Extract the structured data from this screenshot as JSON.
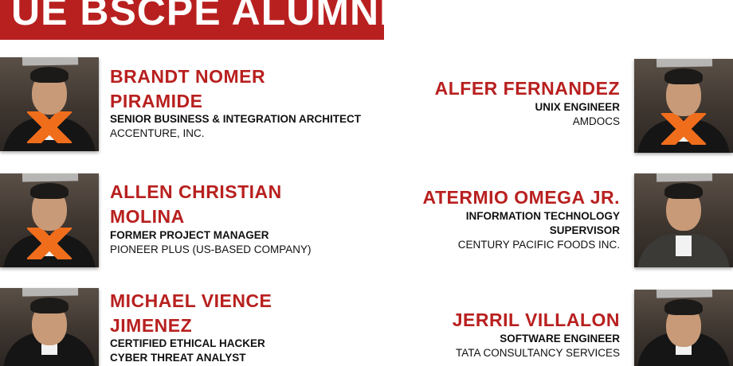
{
  "banner": {
    "title": "UE BSCPE ALUMNI"
  },
  "alumni_left": [
    {
      "name_line1": "BRANDT NOMER",
      "name_line2": "PIRAMIDE",
      "role": "SENIOR BUSINESS & INTEGRATION ARCHITECT",
      "company": "ACCENTURE, INC."
    },
    {
      "name_line1": "ALLEN CHRISTIAN",
      "name_line2": "MOLINA",
      "role": "FORMER PROJECT MANAGER",
      "company": "PIONEER PLUS (US-BASED COMPANY)"
    },
    {
      "name_line1": "MICHAEL VIENCE",
      "name_line2": "JIMENEZ",
      "role": "CERTIFIED ETHICAL HACKER",
      "role2": "CYBER THREAT ANALYST"
    }
  ],
  "alumni_right": [
    {
      "name": "ALFER FERNANDEZ",
      "role": "UNIX ENGINEER",
      "company": "AMDOCS"
    },
    {
      "name": "ATERMIO OMEGA JR.",
      "role_line1": "INFORMATION TECHNOLOGY",
      "role_line2": "SUPERVISOR",
      "company": "CENTURY PACIFIC FOODS INC."
    },
    {
      "name": "JERRIL VILLALON",
      "role": "SOFTWARE ENGINEER",
      "company": "TATA CONSULTANCY SERVICES"
    }
  ],
  "colors": {
    "accent": "#b8201f",
    "text": "#111111",
    "background": "#ffffff"
  }
}
